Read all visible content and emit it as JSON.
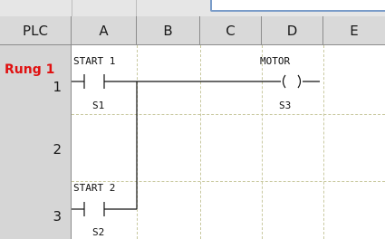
{
  "header": {
    "corner": "PLC",
    "columns": [
      "A",
      "B",
      "C",
      "D",
      "E"
    ]
  },
  "rows": [
    {
      "rung": "Rung 1",
      "number": "1"
    },
    {
      "number": "2"
    },
    {
      "number": "3"
    }
  ],
  "elements": {
    "start1_label": "START 1",
    "s1": "S1",
    "motor_label": "MOTOR",
    "s3": "S3",
    "start2_label": "START 2",
    "s2": "S2"
  }
}
